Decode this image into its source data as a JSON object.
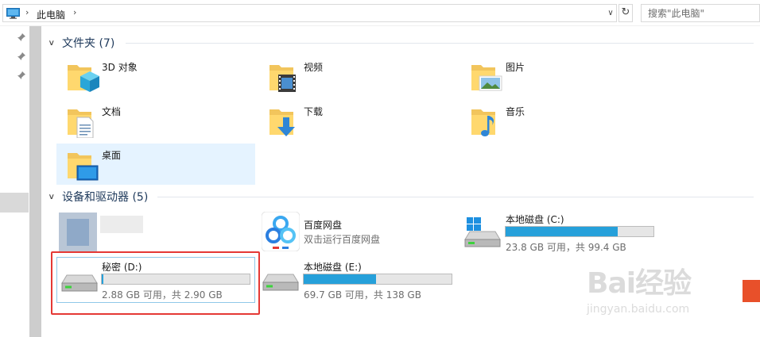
{
  "address_bar": {
    "breadcrumb": "此电脑",
    "dropdown_glyph": "∨",
    "refresh_glyph": "↻",
    "search_placeholder": "搜索\"此电脑\""
  },
  "folders_group": {
    "title": "文件夹 (7)",
    "items": [
      {
        "label": "3D 对象",
        "icon": "3d-objects-folder-icon"
      },
      {
        "label": "视频",
        "icon": "videos-folder-icon"
      },
      {
        "label": "图片",
        "icon": "pictures-folder-icon"
      },
      {
        "label": "文档",
        "icon": "documents-folder-icon"
      },
      {
        "label": "下载",
        "icon": "downloads-folder-icon"
      },
      {
        "label": "音乐",
        "icon": "music-folder-icon"
      },
      {
        "label": "桌面",
        "icon": "desktop-folder-icon"
      }
    ]
  },
  "devices_group": {
    "title": "设备和驱动器 (5)",
    "items": [
      {
        "name": "百度网盘",
        "subtitle": "双击运行百度网盘",
        "icon": "baidu-netdisk-icon"
      },
      {
        "name": "本地磁盘 (C:)",
        "space": "23.8 GB 可用，共 99.4 GB",
        "used_fraction": 0.76,
        "icon": "windows-drive-icon"
      },
      {
        "name": "秘密 (D:)",
        "space": "2.88 GB 可用，共 2.90 GB",
        "used_fraction": 0.01,
        "icon": "hard-drive-icon"
      },
      {
        "name": "本地磁盘 (E:)",
        "space": "69.7 GB 可用，共 138 GB",
        "used_fraction": 0.49,
        "icon": "hard-drive-icon"
      }
    ]
  },
  "watermark": {
    "brand": "Bai经验",
    "url": "jingyan.baidu.com"
  },
  "colors": {
    "accent": "#26a0da",
    "highlight": "#e53935",
    "selection": "#e5f3ff"
  }
}
